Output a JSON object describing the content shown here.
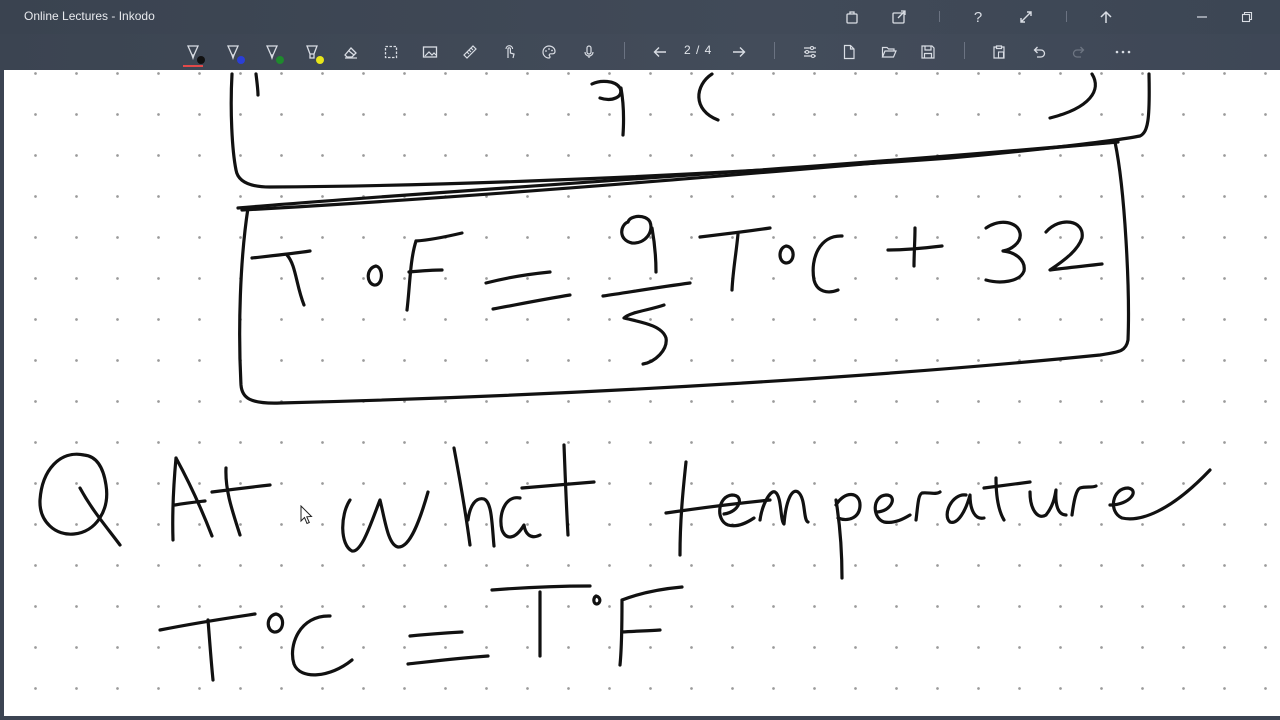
{
  "window": {
    "title": "Online Lectures - Inkodo"
  },
  "titlebar_icons": [
    "store-icon",
    "share-icon",
    "help-icon",
    "expand-icon",
    "upload-icon",
    "minimize-icon",
    "restore-icon"
  ],
  "toolbar": {
    "pens": [
      {
        "name": "pen-black",
        "color": "#111111",
        "selected": true
      },
      {
        "name": "pen-blue",
        "color": "#2b3fd6",
        "selected": false
      },
      {
        "name": "pen-green",
        "color": "#1f8a2d",
        "selected": false
      },
      {
        "name": "highlighter-yellow",
        "color": "#e8e61a",
        "selected": false
      }
    ],
    "tools": [
      "eraser-icon",
      "lasso-select-icon",
      "image-icon",
      "ruler-icon",
      "touch-icon",
      "palette-icon",
      "microphone-icon"
    ],
    "page_indicator": "2 / 4",
    "file_tools": [
      "settings-icon",
      "new-page-icon",
      "open-folder-icon",
      "save-icon"
    ],
    "edit_tools": [
      "paste-icon",
      "undo-icon",
      "redo-icon",
      "more-icon"
    ]
  },
  "colors": {
    "chrome": "#3c4452",
    "ink": "#111111",
    "active_pen_underline": "#e34a4a"
  }
}
